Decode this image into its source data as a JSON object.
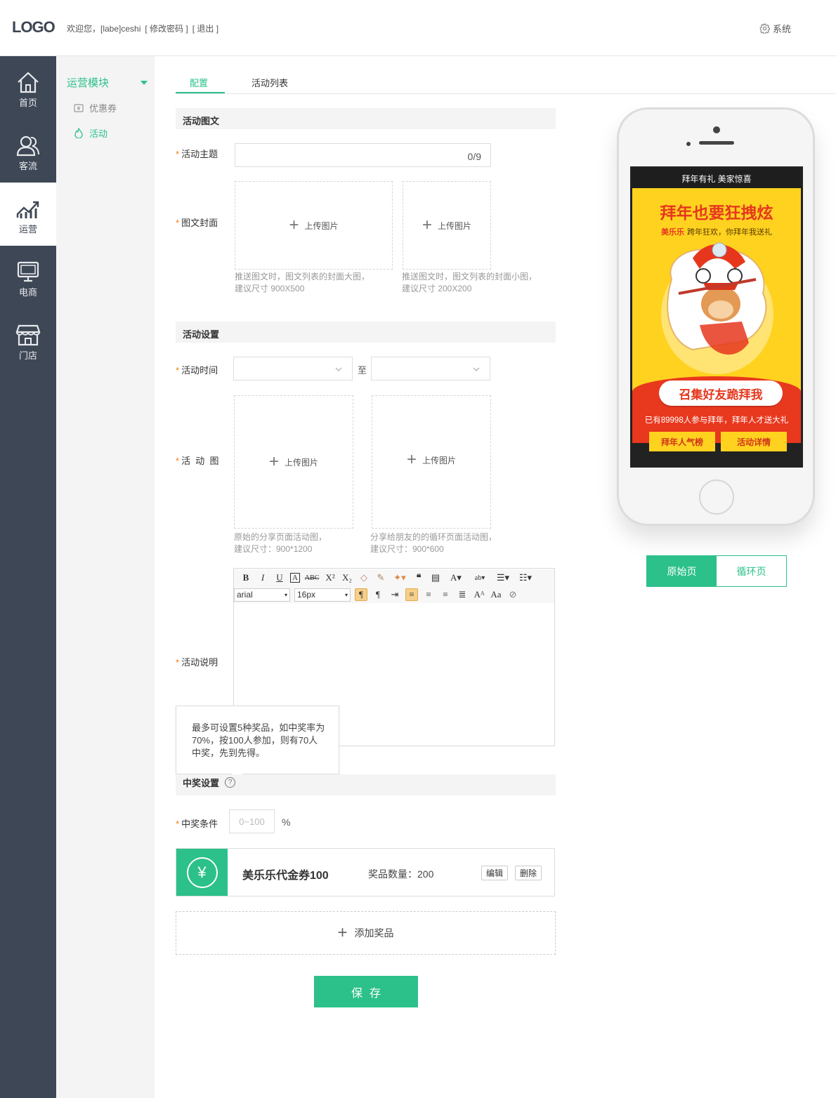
{
  "header": {
    "logo": "LOGO",
    "welcome": "欢迎您，[labe]ceshi",
    "change_password": "[ 修改密码 ]",
    "logout": "[ 退出 ]",
    "system": "系统"
  },
  "nav": {
    "items": [
      {
        "label": "首页",
        "icon": "home-icon"
      },
      {
        "label": "客流",
        "icon": "users-icon"
      },
      {
        "label": "运营",
        "icon": "chart-icon"
      },
      {
        "label": "电商",
        "icon": "monitor-icon"
      },
      {
        "label": "门店",
        "icon": "store-icon"
      }
    ],
    "active": "运营"
  },
  "subnav": {
    "title": "运营模块",
    "items": [
      {
        "label": "优惠券",
        "icon": "ticket-icon"
      },
      {
        "label": "活动",
        "icon": "fire-icon"
      }
    ],
    "active": "活动"
  },
  "tabs": [
    {
      "label": "配置"
    },
    {
      "label": "活动列表"
    }
  ],
  "section1": {
    "title": "活动图文",
    "topic_label": "活动主题",
    "topic_counter": "0/9",
    "cover_label": "图文封面",
    "upload_label": "上传图片",
    "cover_big_hint1": "推送图文时，图文列表的封面大图，",
    "cover_big_hint2": "建议尺寸 900X500",
    "cover_small_hint1": "推送图文时，图文列表的封面小图，",
    "cover_small_hint2": "建议尺寸 200X200"
  },
  "section2": {
    "title": "活动设置",
    "time_label": "活动时间",
    "to": "至",
    "image_label": "活  动  图",
    "share_hint1": "原始的分享页面活动图，",
    "share_hint2": "建议尺寸：900*1200",
    "loop_hint1": "分享给朋友的的循环页面活动图，",
    "loop_hint2": "建议尺寸：900*600",
    "desc_label": "活动说明",
    "font_family": "arial",
    "font_size": "16px"
  },
  "tooltip": "最多可设置5种奖品，如中奖率为70%，按100人参加，则有70人中奖，先到先得。",
  "section3": {
    "title": "中奖设置",
    "condition_label": "中奖条件",
    "condition_placeholder": "0~100",
    "percent": "%"
  },
  "prize": {
    "symbol": "¥",
    "name": "美乐乐代金券100",
    "qty": "奖品数量：200",
    "edit": "编辑",
    "delete": "删除"
  },
  "add_prize": "添加奖品",
  "save": "保存",
  "preview": {
    "screen_title": "拜年有礼 美家惊喜",
    "hero_title": "拜年也要狂拽炫",
    "hero_brand": "美乐乐",
    "hero_sub": "跨年狂欢，你拜年我送礼",
    "pill": "召集好友跪拜我",
    "counter": "已有89998人参与拜年，拜年人才送大礼",
    "btn_left": "拜年人气榜",
    "btn_right": "活动详情"
  },
  "toggle": {
    "original": "原始页",
    "loop": "循环页"
  },
  "colors": {
    "accent": "#2cc08a",
    "sidebar": "#3e4756",
    "required": "#f27c0f"
  }
}
